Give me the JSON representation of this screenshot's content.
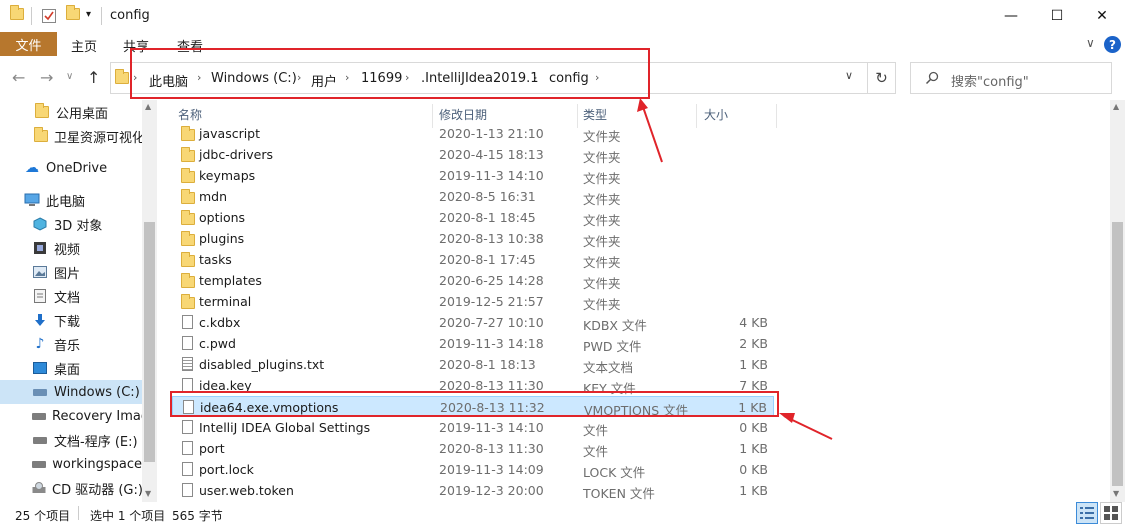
{
  "window": {
    "title": "config",
    "minimize": "—",
    "maximize": "☐",
    "close": "✕"
  },
  "ribbon": {
    "tabs": [
      "文件",
      "主页",
      "共享",
      "查看"
    ],
    "collapse": "∨",
    "help": "?"
  },
  "nav": {
    "back": "←",
    "forward": "→",
    "recent": "∨",
    "up": "↑",
    "breadcrumb": [
      "此电脑",
      "Windows (C:)",
      "用户",
      "11699",
      ".IntelliJIdea2019.1",
      "config"
    ],
    "refresh": "↻",
    "search_placeholder": "搜索\"config\""
  },
  "sidebar": {
    "items": [
      {
        "label": "公用桌面",
        "icon": "folder-icon"
      },
      {
        "label": "卫星资源可视化",
        "icon": "folder-icon"
      },
      {
        "label": "OneDrive",
        "icon": "cloud-icon"
      },
      {
        "label": "此电脑",
        "icon": "computer-icon"
      },
      {
        "label": "3D 对象",
        "icon": "cube-icon"
      },
      {
        "label": "视频",
        "icon": "video-icon"
      },
      {
        "label": "图片",
        "icon": "picture-icon"
      },
      {
        "label": "文档",
        "icon": "document-icon"
      },
      {
        "label": "下载",
        "icon": "download-icon"
      },
      {
        "label": "音乐",
        "icon": "music-icon"
      },
      {
        "label": "桌面",
        "icon": "desktop-icon"
      },
      {
        "label": "Windows (C:)",
        "icon": "drive-icon"
      },
      {
        "label": "Recovery Image",
        "icon": "drive-icon"
      },
      {
        "label": "文档-程序 (E:)",
        "icon": "drive-icon"
      },
      {
        "label": "workingspace",
        "icon": "drive-icon"
      },
      {
        "label": "CD 驱动器 (G:)",
        "icon": "cd-drive-icon"
      }
    ],
    "selected": "Windows (C:)"
  },
  "columns": {
    "name": "名称",
    "date": "修改日期",
    "type": "类型",
    "size": "大小"
  },
  "files": [
    {
      "name": "javascript",
      "date": "2020-1-13 21:10",
      "type": "文件夹",
      "size": "",
      "kind": "folder"
    },
    {
      "name": "jdbc-drivers",
      "date": "2020-4-15 18:13",
      "type": "文件夹",
      "size": "",
      "kind": "folder"
    },
    {
      "name": "keymaps",
      "date": "2019-11-3 14:10",
      "type": "文件夹",
      "size": "",
      "kind": "folder"
    },
    {
      "name": "mdn",
      "date": "2020-8-5 16:31",
      "type": "文件夹",
      "size": "",
      "kind": "folder"
    },
    {
      "name": "options",
      "date": "2020-8-1 18:45",
      "type": "文件夹",
      "size": "",
      "kind": "folder"
    },
    {
      "name": "plugins",
      "date": "2020-8-13 10:38",
      "type": "文件夹",
      "size": "",
      "kind": "folder"
    },
    {
      "name": "tasks",
      "date": "2020-8-1 17:45",
      "type": "文件夹",
      "size": "",
      "kind": "folder"
    },
    {
      "name": "templates",
      "date": "2020-6-25 14:28",
      "type": "文件夹",
      "size": "",
      "kind": "folder"
    },
    {
      "name": "terminal",
      "date": "2019-12-5 21:57",
      "type": "文件夹",
      "size": "",
      "kind": "folder"
    },
    {
      "name": "c.kdbx",
      "date": "2020-7-27 10:10",
      "type": "KDBX 文件",
      "size": "4 KB",
      "kind": "file"
    },
    {
      "name": "c.pwd",
      "date": "2019-11-3 14:18",
      "type": "PWD 文件",
      "size": "2 KB",
      "kind": "file"
    },
    {
      "name": "disabled_plugins.txt",
      "date": "2020-8-1 18:13",
      "type": "文本文档",
      "size": "1 KB",
      "kind": "text"
    },
    {
      "name": "idea.key",
      "date": "2020-8-13 11:30",
      "type": "KEY 文件",
      "size": "7 KB",
      "kind": "file"
    },
    {
      "name": "idea64.exe.vmoptions",
      "date": "2020-8-13 11:32",
      "type": "VMOPTIONS 文件",
      "size": "1 KB",
      "kind": "file"
    },
    {
      "name": "IntelliJ IDEA Global Settings",
      "date": "2019-11-3 14:10",
      "type": "文件",
      "size": "0 KB",
      "kind": "file"
    },
    {
      "name": "port",
      "date": "2020-8-13 11:30",
      "type": "文件",
      "size": "1 KB",
      "kind": "file"
    },
    {
      "name": "port.lock",
      "date": "2019-11-3 14:09",
      "type": "LOCK 文件",
      "size": "0 KB",
      "kind": "file"
    },
    {
      "name": "user.web.token",
      "date": "2019-12-3 20:00",
      "type": "TOKEN 文件",
      "size": "1 KB",
      "kind": "file"
    }
  ],
  "selected_file": "idea64.exe.vmoptions",
  "status": {
    "count": "25 个项目",
    "selection": "选中 1 个项目",
    "size": "565 字节"
  },
  "colors": {
    "file_tab": "#b7772d",
    "selection": "#cce8ff",
    "annotation": "#e0242a"
  }
}
